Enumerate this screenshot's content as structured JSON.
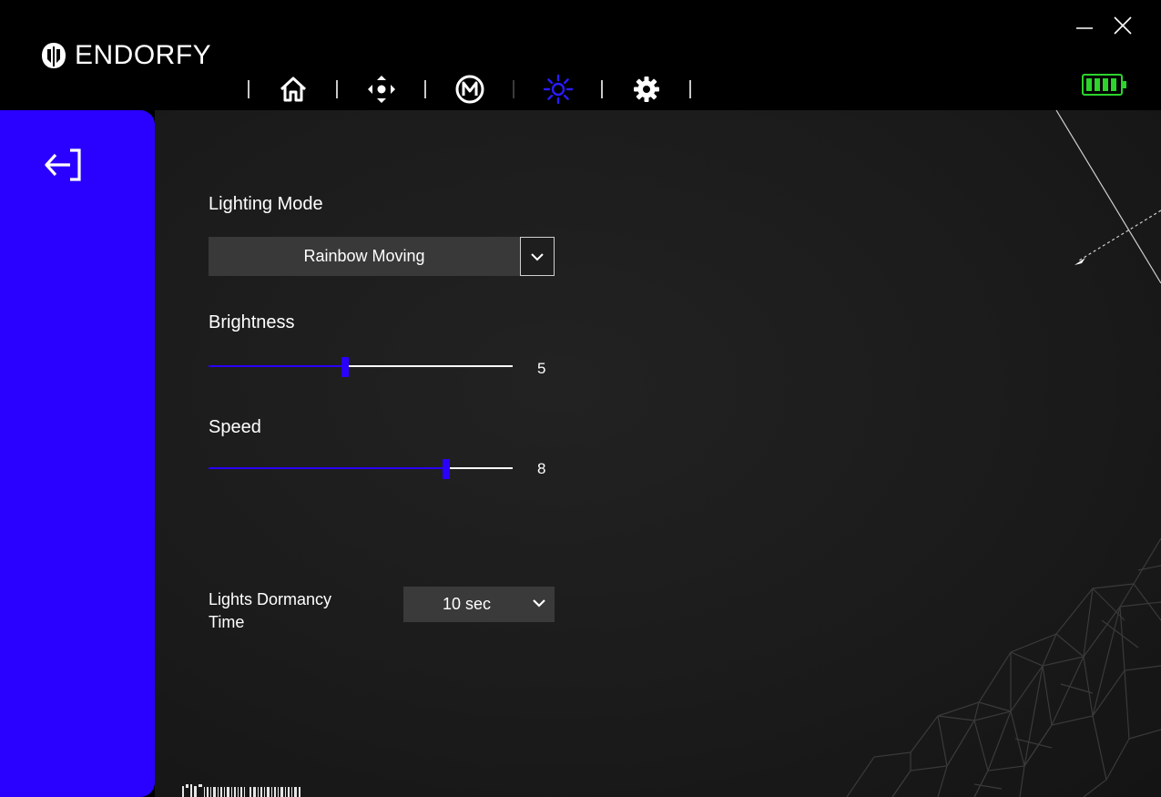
{
  "app": {
    "brand": "ENDORFY"
  },
  "colors": {
    "accent": "#2a00ff",
    "battery": "#2cd42c",
    "panel": "#1b1b1b"
  },
  "window_controls": {
    "minimize": "minimize-icon",
    "close": "close-icon"
  },
  "nav": {
    "items": [
      {
        "id": "home",
        "icon": "home-icon",
        "active": false
      },
      {
        "id": "buttons",
        "icon": "dpad-icon",
        "active": false
      },
      {
        "id": "macro",
        "icon": "macro-m-icon",
        "active": false
      },
      {
        "id": "lighting",
        "icon": "sun-icon",
        "active": true
      },
      {
        "id": "settings",
        "icon": "gear-icon",
        "active": false
      }
    ]
  },
  "battery": {
    "icon": "battery-icon",
    "level": 1.0
  },
  "sidebar": {
    "back_icon": "exit-arrow-icon"
  },
  "lighting": {
    "mode_label": "Lighting Mode",
    "mode_value": "Rainbow Moving",
    "brightness_label": "Brightness",
    "brightness_value": "5",
    "brightness_fraction": 0.45,
    "speed_label": "Speed",
    "speed_value": "8",
    "speed_fraction": 0.78,
    "dormancy_label": "Lights Dormancy Time",
    "dormancy_value": "10 sec"
  }
}
